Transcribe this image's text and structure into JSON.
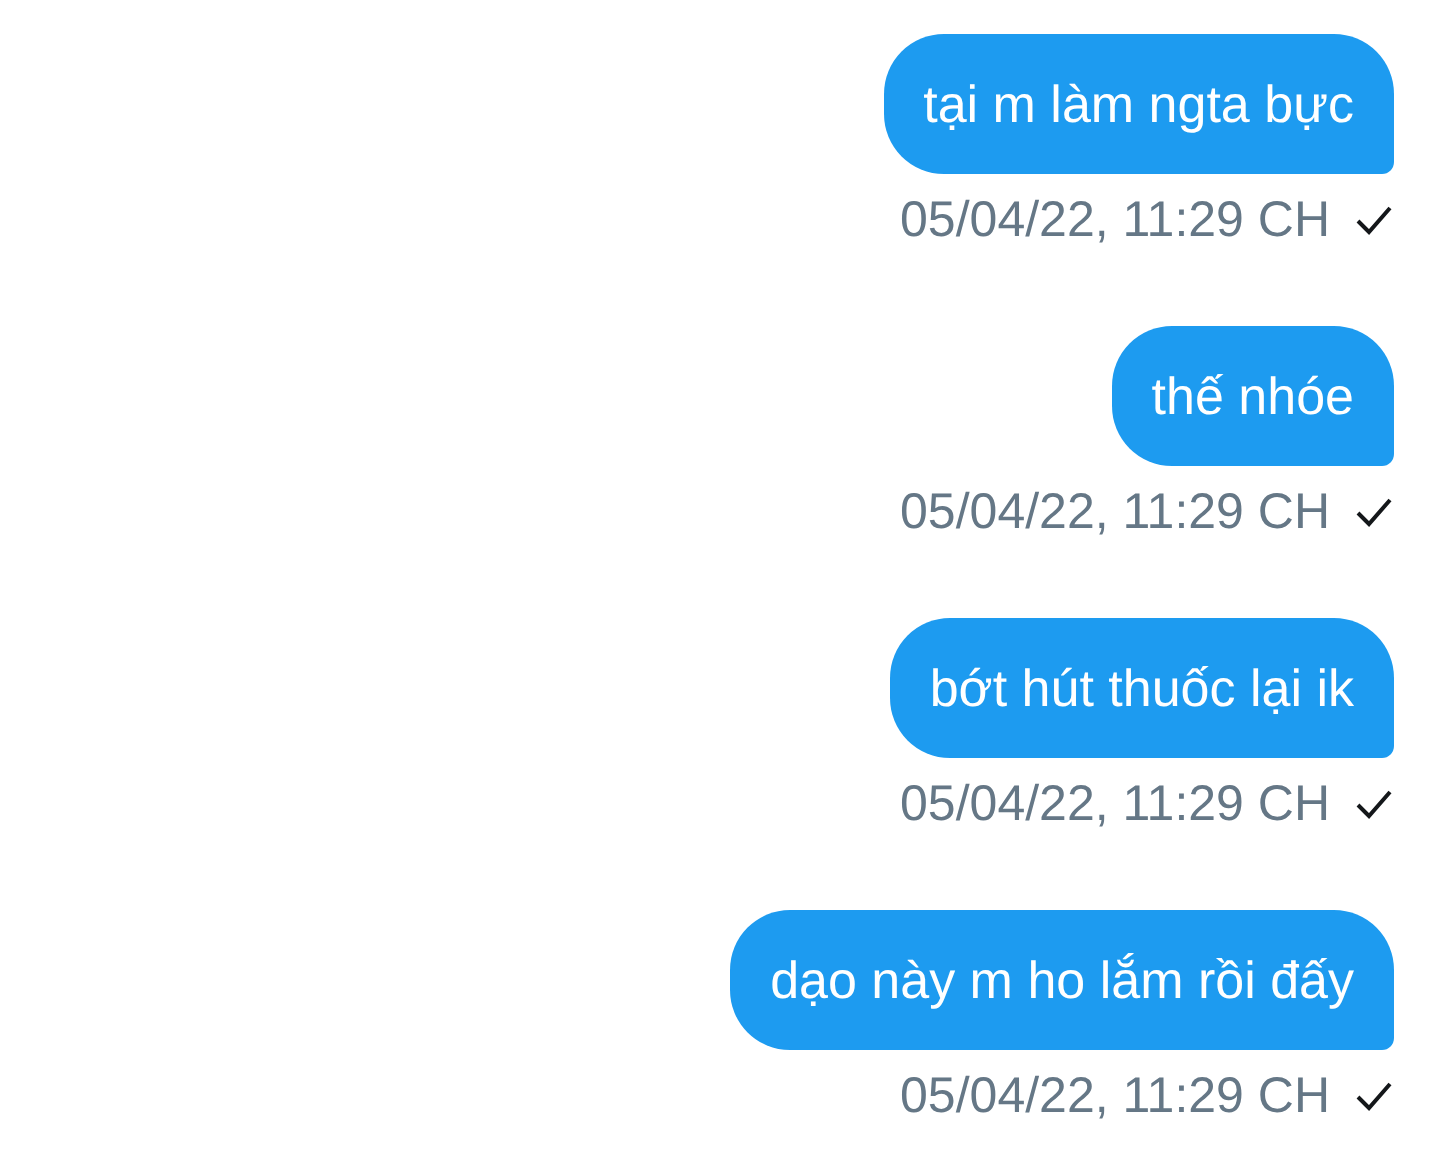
{
  "messages": [
    {
      "text": "tại m làm ngta bực",
      "time": "05/04/22, 11:29 CH"
    },
    {
      "text": "thế nhóe",
      "time": "05/04/22, 11:29 CH"
    },
    {
      "text": "bớt hút thuốc lại ik",
      "time": "05/04/22, 11:29 CH"
    },
    {
      "text": "dạo này m ho lắm rồi đấy",
      "time": "05/04/22, 11:29 CH"
    }
  ]
}
